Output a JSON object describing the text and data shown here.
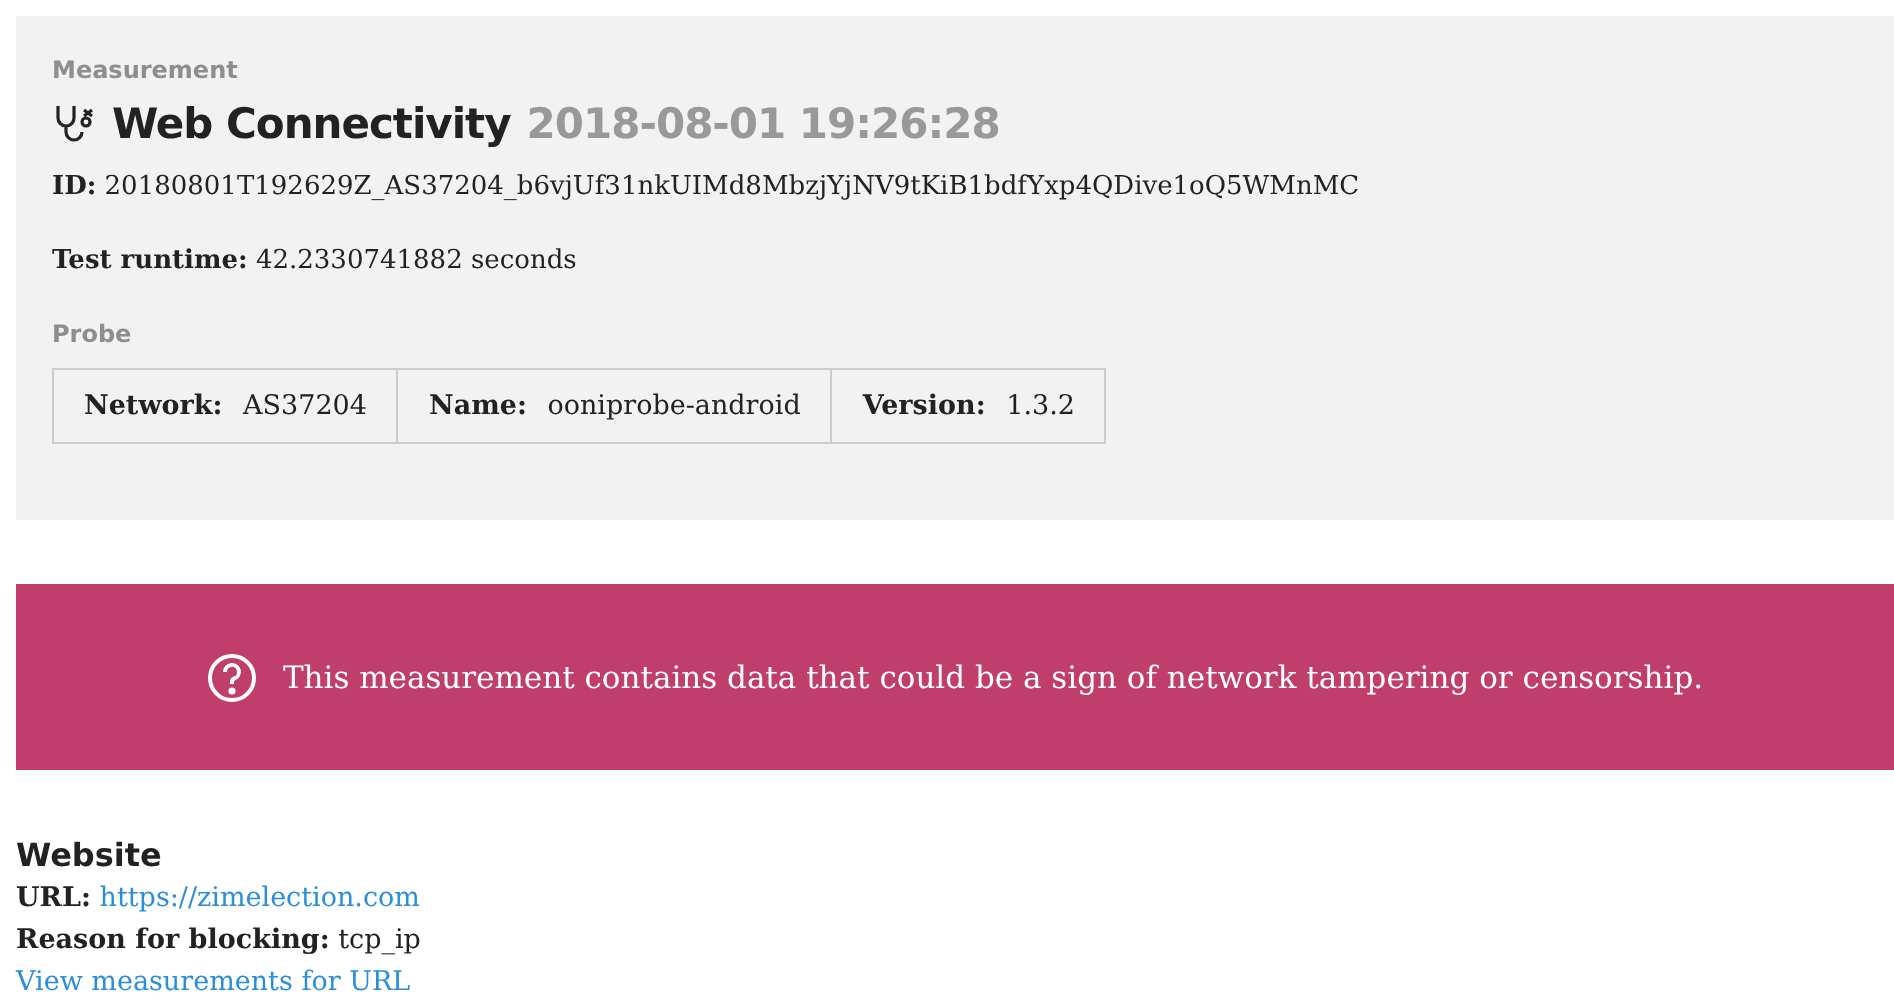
{
  "header": {
    "section_label": "Measurement",
    "title": "Web Connectivity",
    "date": "2018-08-01 19:26:28",
    "id_line": "**ID:** 20180801T192629Z_AS37204_b6vjUf31nkUIMd8MbzjYjNV9tKiB1bdfYxp4QDive1oQ5WMnMC",
    "runtime_line": "**Test runtime:** 42.2330741882 seconds"
  },
  "probe": {
    "label": "Probe",
    "cells": [
      {
        "label": "Network:",
        "value": "AS37204"
      },
      {
        "label": "Name:",
        "value": "ooniprobe-android"
      },
      {
        "label": "Version:",
        "value": "1.3.2"
      }
    ]
  },
  "alert": {
    "kind": "anomaly",
    "text": "This measurement contains data that could be a sign of network tampering or censorship."
  },
  "website": {
    "heading": "Website",
    "url_label": "URL:",
    "url": "https://zimelection.com",
    "reason_line": "**Reason for blocking:** tcp_ip",
    "view_link": "View measurements for URL"
  }
}
